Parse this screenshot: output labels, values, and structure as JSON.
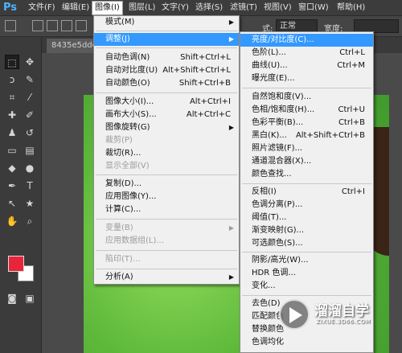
{
  "app": {
    "logo": "Ps"
  },
  "menubar": {
    "items": [
      {
        "label": "文件(F)"
      },
      {
        "label": "编辑(E)"
      },
      {
        "label": "图像(I)"
      },
      {
        "label": "图层(L)"
      },
      {
        "label": "文字(Y)"
      },
      {
        "label": "选择(S)"
      },
      {
        "label": "滤镜(T)"
      },
      {
        "label": "视图(V)"
      },
      {
        "label": "窗口(W)"
      },
      {
        "label": "帮助(H)"
      }
    ]
  },
  "options_bar": {
    "style_label": "式:",
    "style_value": "正常",
    "width_label": "宽度:"
  },
  "document": {
    "tab_label": "8435e5dde7"
  },
  "image_menu": {
    "items": [
      {
        "label": "模式(M)",
        "shortcut": "",
        "submenu": true
      },
      {
        "label": "调整(J)",
        "shortcut": "",
        "submenu": true
      },
      {
        "label": "自动色调(N)",
        "shortcut": "Shift+Ctrl+L"
      },
      {
        "label": "自动对比度(U)",
        "shortcut": "Alt+Shift+Ctrl+L"
      },
      {
        "label": "自动颜色(O)",
        "shortcut": "Shift+Ctrl+B"
      },
      {
        "label": "图像大小(I)...",
        "shortcut": "Alt+Ctrl+I"
      },
      {
        "label": "画布大小(S)...",
        "shortcut": "Alt+Ctrl+C"
      },
      {
        "label": "图像旋转(G)",
        "shortcut": "",
        "submenu": true
      },
      {
        "label": "裁剪(P)",
        "shortcut": "",
        "disabled": true
      },
      {
        "label": "裁切(R)...",
        "shortcut": ""
      },
      {
        "label": "显示全部(V)",
        "shortcut": "",
        "disabled": true
      },
      {
        "label": "复制(D)...",
        "shortcut": ""
      },
      {
        "label": "应用图像(Y)...",
        "shortcut": ""
      },
      {
        "label": "计算(C)...",
        "shortcut": ""
      },
      {
        "label": "变量(B)",
        "shortcut": "",
        "submenu": true,
        "disabled": true
      },
      {
        "label": "应用数据组(L)...",
        "shortcut": "",
        "disabled": true
      },
      {
        "label": "陷印(T)...",
        "shortcut": "",
        "disabled": true
      },
      {
        "label": "分析(A)",
        "shortcut": "",
        "submenu": true
      }
    ]
  },
  "adjust_menu": {
    "items": [
      {
        "label": "亮度/对比度(C)...",
        "shortcut": ""
      },
      {
        "label": "色阶(L)...",
        "shortcut": "Ctrl+L"
      },
      {
        "label": "曲线(U)...",
        "shortcut": "Ctrl+M"
      },
      {
        "label": "曝光度(E)...",
        "shortcut": ""
      },
      {
        "label": "自然饱和度(V)...",
        "shortcut": ""
      },
      {
        "label": "色相/饱和度(H)...",
        "shortcut": "Ctrl+U"
      },
      {
        "label": "色彩平衡(B)...",
        "shortcut": "Ctrl+B"
      },
      {
        "label": "黑白(K)...",
        "shortcut": "Alt+Shift+Ctrl+B"
      },
      {
        "label": "照片滤镜(F)...",
        "shortcut": ""
      },
      {
        "label": "通道混合器(X)...",
        "shortcut": ""
      },
      {
        "label": "颜色查找...",
        "shortcut": ""
      },
      {
        "label": "反相(I)",
        "shortcut": "Ctrl+I"
      },
      {
        "label": "色调分离(P)...",
        "shortcut": ""
      },
      {
        "label": "阈值(T)...",
        "shortcut": ""
      },
      {
        "label": "渐变映射(G)...",
        "shortcut": ""
      },
      {
        "label": "可选颜色(S)...",
        "shortcut": ""
      },
      {
        "label": "阴影/高光(W)...",
        "shortcut": ""
      },
      {
        "label": "HDR 色调...",
        "shortcut": ""
      },
      {
        "label": "变化...",
        "shortcut": ""
      },
      {
        "label": "去色(D)",
        "shortcut": ""
      },
      {
        "label": "匹配颜色",
        "shortcut": ""
      },
      {
        "label": "替换颜色",
        "shortcut": ""
      },
      {
        "label": "色调均化",
        "shortcut": ""
      }
    ]
  },
  "watermark": {
    "title": "溜溜自学",
    "subtitle": "ZIXUE.3D66.COM"
  },
  "colors": {
    "highlight": "#3399ff",
    "foreground": "#e8253a",
    "background": "#ffffff"
  }
}
